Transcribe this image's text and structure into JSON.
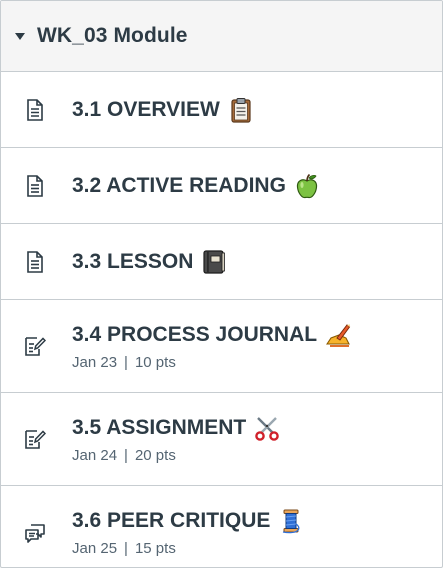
{
  "module": {
    "title": "WK_03 Module"
  },
  "items": [
    {
      "title": "3.1 OVERVIEW",
      "icon": "page-icon",
      "emoji": "clipboard"
    },
    {
      "title": "3.2 ACTIVE READING",
      "icon": "page-icon",
      "emoji": "green-apple"
    },
    {
      "title": "3.3 LESSON",
      "icon": "page-icon",
      "emoji": "notebook"
    },
    {
      "title": "3.4 PROCESS JOURNAL",
      "icon": "assignment-icon",
      "emoji": "writing-hand",
      "date": "Jan 23",
      "points": "10 pts"
    },
    {
      "title": "3.5 ASSIGNMENT",
      "icon": "assignment-icon",
      "emoji": "scissors",
      "date": "Jan 24",
      "points": "20 pts"
    },
    {
      "title": "3.6 PEER CRITIQUE",
      "icon": "discussion-icon",
      "emoji": "thread-spool",
      "date": "Jan 25",
      "points": "15 pts"
    }
  ],
  "meta_separator": "|",
  "colors": {
    "text": "#2d3b45",
    "meta": "#556572",
    "border": "#c7cdd1",
    "header_bg": "#f5f5f5"
  }
}
